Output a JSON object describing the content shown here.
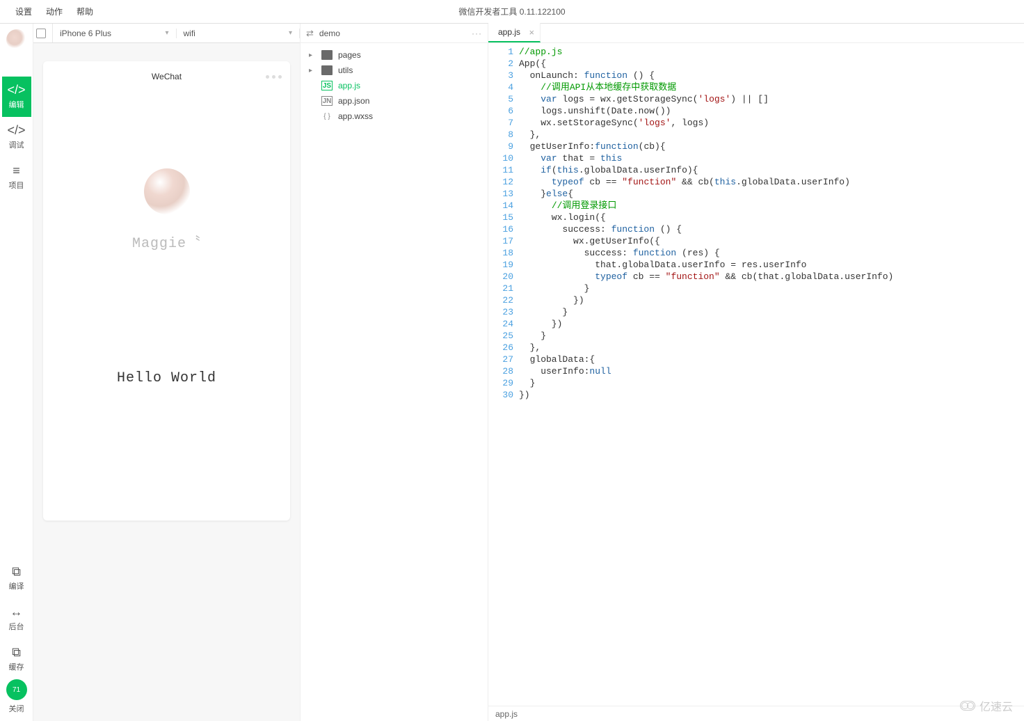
{
  "app": {
    "title": "微信开发者工具 0.11.122100"
  },
  "menu": {
    "settings": "设置",
    "actions": "动作",
    "help": "帮助"
  },
  "leftbar": {
    "edit": "编辑",
    "debug": "调试",
    "project": "项目",
    "compile": "编译",
    "background": "后台",
    "cache": "缓存",
    "close": "关闭"
  },
  "devicebar": {
    "device": "iPhone 6 Plus",
    "network": "wifi"
  },
  "simulator": {
    "title": "WeChat",
    "username": "Maggie〝",
    "hello": "Hello World"
  },
  "tree": {
    "project": "demo",
    "items": [
      {
        "type": "folder",
        "name": "pages"
      },
      {
        "type": "folder",
        "name": "utils"
      },
      {
        "type": "file-js",
        "name": "app.js",
        "active": true,
        "badge": "JS"
      },
      {
        "type": "file-json",
        "name": "app.json",
        "badge": "JN"
      },
      {
        "type": "file-wxss",
        "name": "app.wxss",
        "badge": "{ }"
      }
    ]
  },
  "tabs": {
    "active": "app.js"
  },
  "status": {
    "path": "app.js"
  },
  "watermark": "亿速云",
  "code": {
    "lines": [
      {
        "n": 1,
        "t": [
          {
            "c": "cm",
            "v": "//app.js"
          }
        ]
      },
      {
        "n": 2,
        "t": [
          {
            "v": "App({"
          }
        ]
      },
      {
        "n": 3,
        "t": [
          {
            "v": "  onLaunch: "
          },
          {
            "c": "kw",
            "v": "function"
          },
          {
            "v": " () {"
          }
        ]
      },
      {
        "n": 4,
        "t": [
          {
            "v": "    "
          },
          {
            "c": "cm",
            "v": "//调用API从本地缓存中获取数据"
          }
        ]
      },
      {
        "n": 5,
        "t": [
          {
            "v": "    "
          },
          {
            "c": "kw",
            "v": "var"
          },
          {
            "v": " logs = wx.getStorageSync("
          },
          {
            "c": "str",
            "v": "'logs'"
          },
          {
            "v": ") || []"
          }
        ]
      },
      {
        "n": 6,
        "t": [
          {
            "v": "    logs.unshift(Date.now())"
          }
        ]
      },
      {
        "n": 7,
        "t": [
          {
            "v": "    wx.setStorageSync("
          },
          {
            "c": "str",
            "v": "'logs'"
          },
          {
            "v": ", logs)"
          }
        ]
      },
      {
        "n": 8,
        "t": [
          {
            "v": "  },"
          }
        ]
      },
      {
        "n": 9,
        "t": [
          {
            "v": "  getUserInfo:"
          },
          {
            "c": "kw",
            "v": "function"
          },
          {
            "v": "(cb){"
          }
        ]
      },
      {
        "n": 10,
        "t": [
          {
            "v": "    "
          },
          {
            "c": "kw",
            "v": "var"
          },
          {
            "v": " that = "
          },
          {
            "c": "kw",
            "v": "this"
          }
        ]
      },
      {
        "n": 11,
        "t": [
          {
            "v": "    "
          },
          {
            "c": "kw",
            "v": "if"
          },
          {
            "v": "("
          },
          {
            "c": "kw",
            "v": "this"
          },
          {
            "v": ".globalData.userInfo){"
          }
        ]
      },
      {
        "n": 12,
        "t": [
          {
            "v": "      "
          },
          {
            "c": "kw",
            "v": "typeof"
          },
          {
            "v": " cb == "
          },
          {
            "c": "str",
            "v": "\"function\""
          },
          {
            "v": " && cb("
          },
          {
            "c": "kw",
            "v": "this"
          },
          {
            "v": ".globalData.userInfo)"
          }
        ]
      },
      {
        "n": 13,
        "t": [
          {
            "v": "    }"
          },
          {
            "c": "kw",
            "v": "else"
          },
          {
            "v": "{"
          }
        ]
      },
      {
        "n": 14,
        "t": [
          {
            "v": "      "
          },
          {
            "c": "cm",
            "v": "//调用登录接口"
          }
        ]
      },
      {
        "n": 15,
        "t": [
          {
            "v": "      wx.login({"
          }
        ]
      },
      {
        "n": 16,
        "t": [
          {
            "v": "        success: "
          },
          {
            "c": "kw",
            "v": "function"
          },
          {
            "v": " () {"
          }
        ]
      },
      {
        "n": 17,
        "t": [
          {
            "v": "          wx.getUserInfo({"
          }
        ]
      },
      {
        "n": 18,
        "t": [
          {
            "v": "            success: "
          },
          {
            "c": "kw",
            "v": "function"
          },
          {
            "v": " (res) {"
          }
        ]
      },
      {
        "n": 19,
        "t": [
          {
            "v": "              that.globalData.userInfo = res.userInfo"
          }
        ]
      },
      {
        "n": 20,
        "t": [
          {
            "v": "              "
          },
          {
            "c": "kw",
            "v": "typeof"
          },
          {
            "v": " cb == "
          },
          {
            "c": "str",
            "v": "\"function\""
          },
          {
            "v": " && cb(that.globalData.userInfo)"
          }
        ]
      },
      {
        "n": 21,
        "t": [
          {
            "v": "            }"
          }
        ]
      },
      {
        "n": 22,
        "t": [
          {
            "v": "          })"
          }
        ]
      },
      {
        "n": 23,
        "t": [
          {
            "v": "        }"
          }
        ]
      },
      {
        "n": 24,
        "t": [
          {
            "v": "      })"
          }
        ]
      },
      {
        "n": 25,
        "t": [
          {
            "v": "    }"
          }
        ]
      },
      {
        "n": 26,
        "t": [
          {
            "v": "  },"
          }
        ]
      },
      {
        "n": 27,
        "t": [
          {
            "v": "  globalData:{"
          }
        ]
      },
      {
        "n": 28,
        "t": [
          {
            "v": "    userInfo:"
          },
          {
            "c": "kw",
            "v": "null"
          }
        ]
      },
      {
        "n": 29,
        "t": [
          {
            "v": "  }"
          }
        ]
      },
      {
        "n": 30,
        "t": [
          {
            "v": "})"
          }
        ]
      }
    ]
  }
}
